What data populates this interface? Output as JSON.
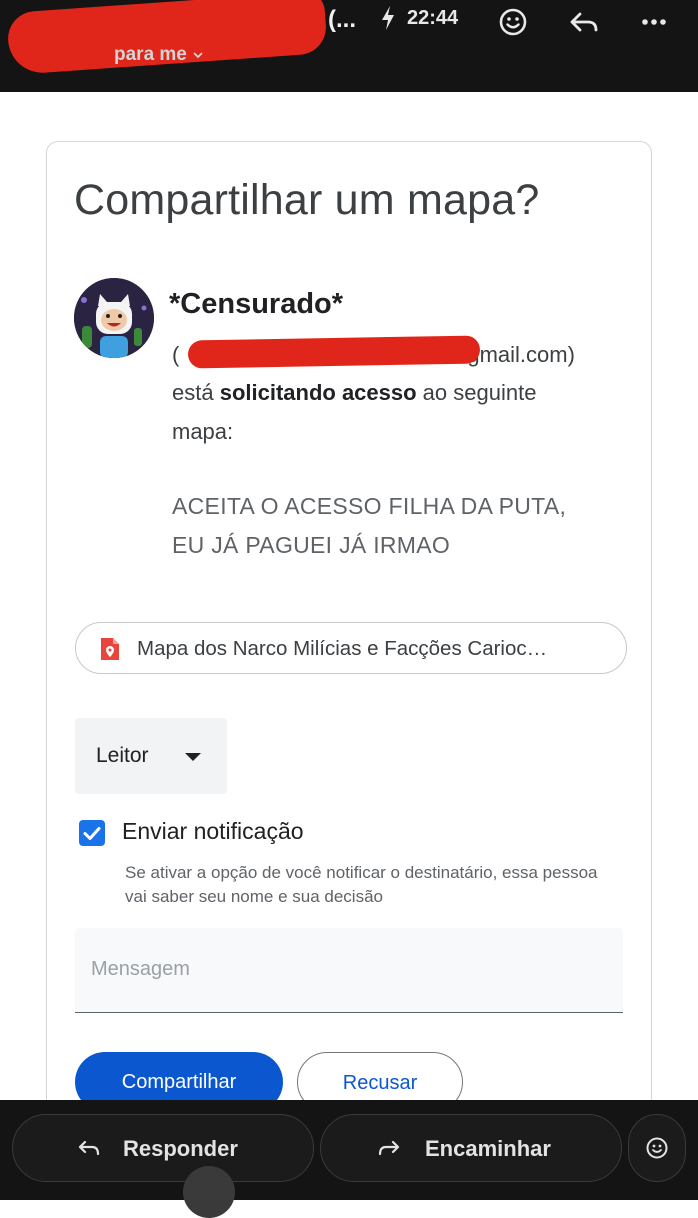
{
  "header": {
    "sender_truncated": "(...",
    "time": "22:44",
    "recipient": "para me"
  },
  "card": {
    "title": "Compartilhar um mapa?",
    "requester_name": "*Censurado*",
    "email_suffix": "gmail.com)",
    "email_prefix": "(",
    "request_part1": "está ",
    "request_bold": "solicitando acesso",
    "request_part2": " ao seguinte",
    "request_part3": "mapa:",
    "message_line1": "ACEITA O ACESSO FILHA DA PUTA,",
    "message_line2": "EU JÁ PAGUEI JÁ IRMAO",
    "file_name": "Mapa dos Narco Milícias e Facções Carioc…",
    "role": "Leitor",
    "notify_label": "Enviar notificação",
    "notify_checked": true,
    "notify_help": "Se ativar a opção de você notificar o destinatário, essa pessoa vai saber seu nome e sua decisão",
    "message_placeholder": "Mensagem",
    "share_button": "Compartilhar",
    "decline_button": "Recusar"
  },
  "bottom": {
    "reply": "Responder",
    "forward": "Encaminhar"
  },
  "colors": {
    "primary": "#0b57d0",
    "checkbox": "#1a73e8",
    "redaction": "#e0261a",
    "header_bg": "#141414"
  }
}
